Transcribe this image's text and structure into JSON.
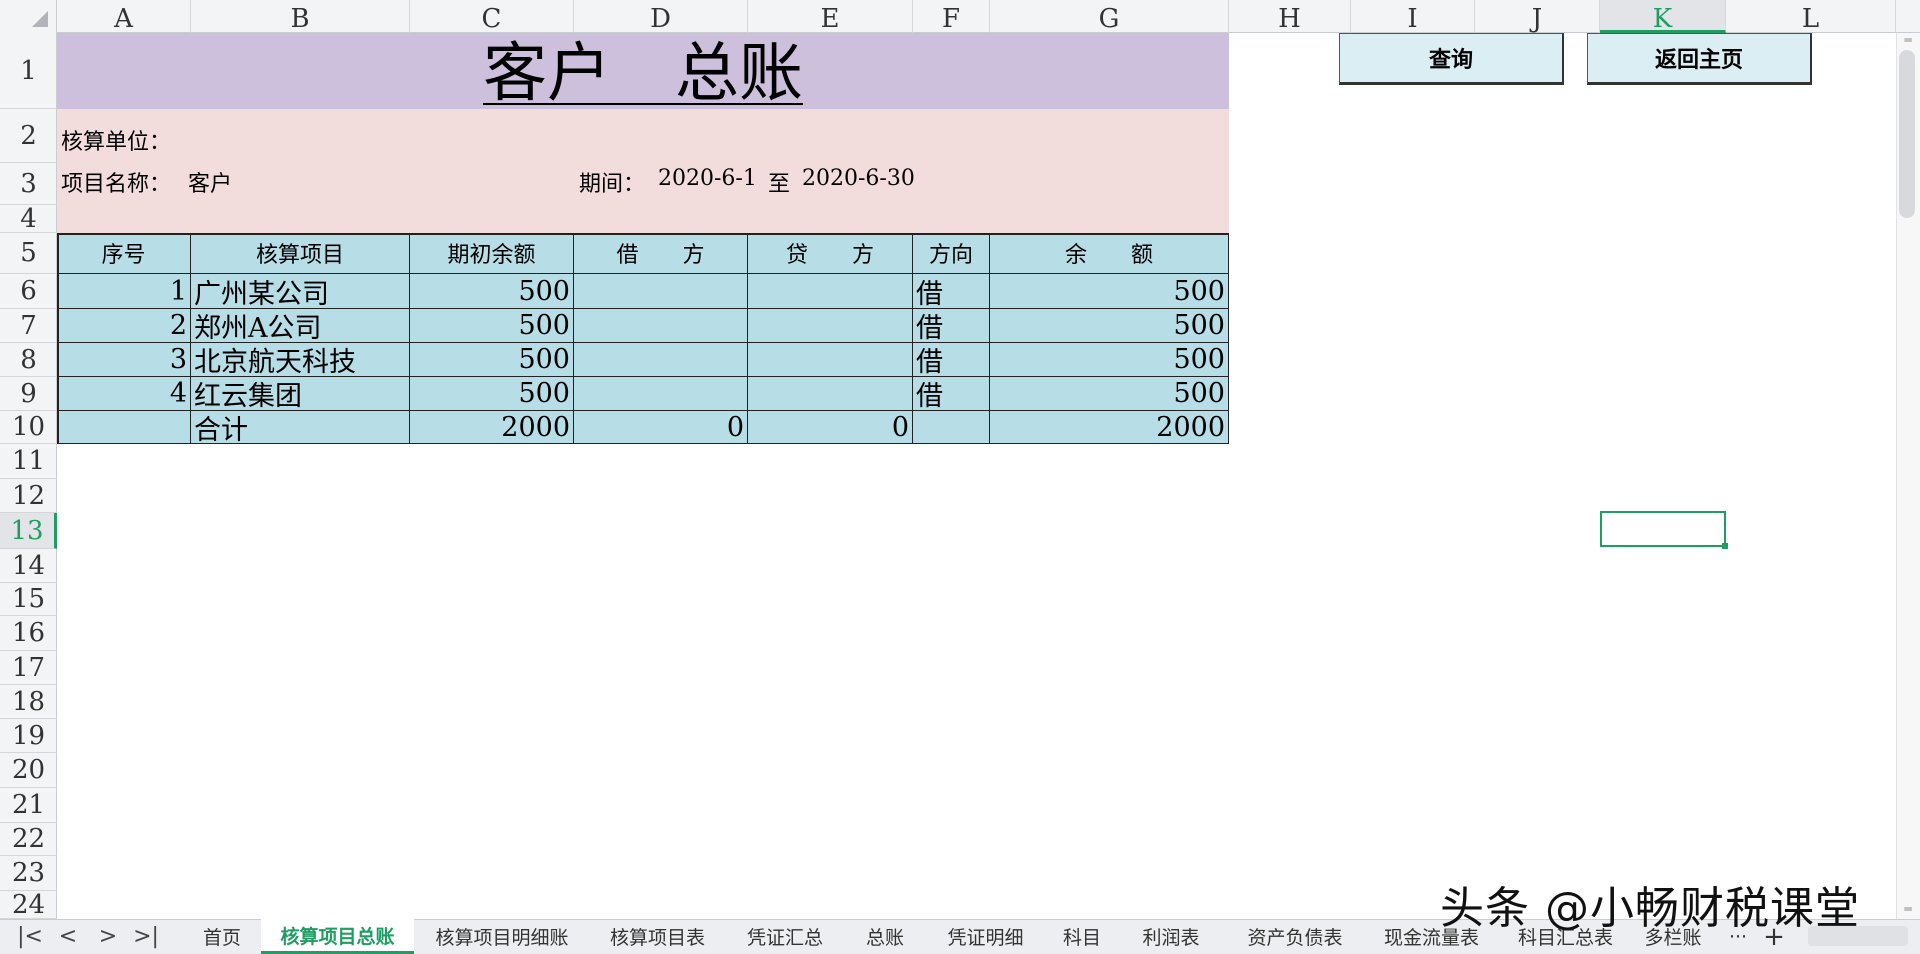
{
  "columns": [
    "A",
    "B",
    "C",
    "D",
    "E",
    "F",
    "G",
    "H",
    "I",
    "J",
    "K",
    "L"
  ],
  "active_column": "K",
  "rows": [
    "1",
    "2",
    "3",
    "4",
    "5",
    "6",
    "7",
    "8",
    "9",
    "10",
    "11",
    "12",
    "13",
    "14",
    "15",
    "16",
    "17",
    "18",
    "19",
    "20",
    "21",
    "22",
    "23",
    "24"
  ],
  "active_row": "13",
  "title": "客户　总账",
  "unit_label": "核算单位：",
  "item_label": "项目名称：",
  "item_value": "客户",
  "period_label": "期间：",
  "period_from": "2020-6-1",
  "period_to_word": "至",
  "period_to": "2020-6-30",
  "table": {
    "headers": [
      "序号",
      "核算项目",
      "期初余额",
      "借　　方",
      "贷　　方",
      "方向",
      "余　　额"
    ],
    "rows": [
      {
        "no": "1",
        "name": "广州某公司",
        "opening": "500",
        "debit": "",
        "credit": "",
        "dir": "借",
        "balance": "500"
      },
      {
        "no": "2",
        "name": "郑州A公司",
        "opening": "500",
        "debit": "",
        "credit": "",
        "dir": "借",
        "balance": "500"
      },
      {
        "no": "3",
        "name": "北京航天科技",
        "opening": "500",
        "debit": "",
        "credit": "",
        "dir": "借",
        "balance": "500"
      },
      {
        "no": "4",
        "name": "红云集团",
        "opening": "500",
        "debit": "",
        "credit": "",
        "dir": "借",
        "balance": "500"
      },
      {
        "no": "",
        "name": "合计",
        "opening": "2000",
        "debit": "0",
        "credit": "0",
        "dir": "",
        "balance": "2000"
      }
    ]
  },
  "buttons": {
    "query": "查询",
    "home": "返回主页"
  },
  "sheet_tabs": [
    "首页",
    "核算项目总账",
    "核算项目明细账",
    "核算项目表",
    "凭证汇总",
    "总账",
    "凭证明细",
    "科目",
    "利润表",
    "资产负债表",
    "现金流量表",
    "科目汇总表",
    "多栏账"
  ],
  "active_tab": "核算项目总账",
  "tab_overflow": "···",
  "tab_add": "+",
  "watermark": "头条 @小畅财税课堂",
  "accent_color": "#1f9d63"
}
